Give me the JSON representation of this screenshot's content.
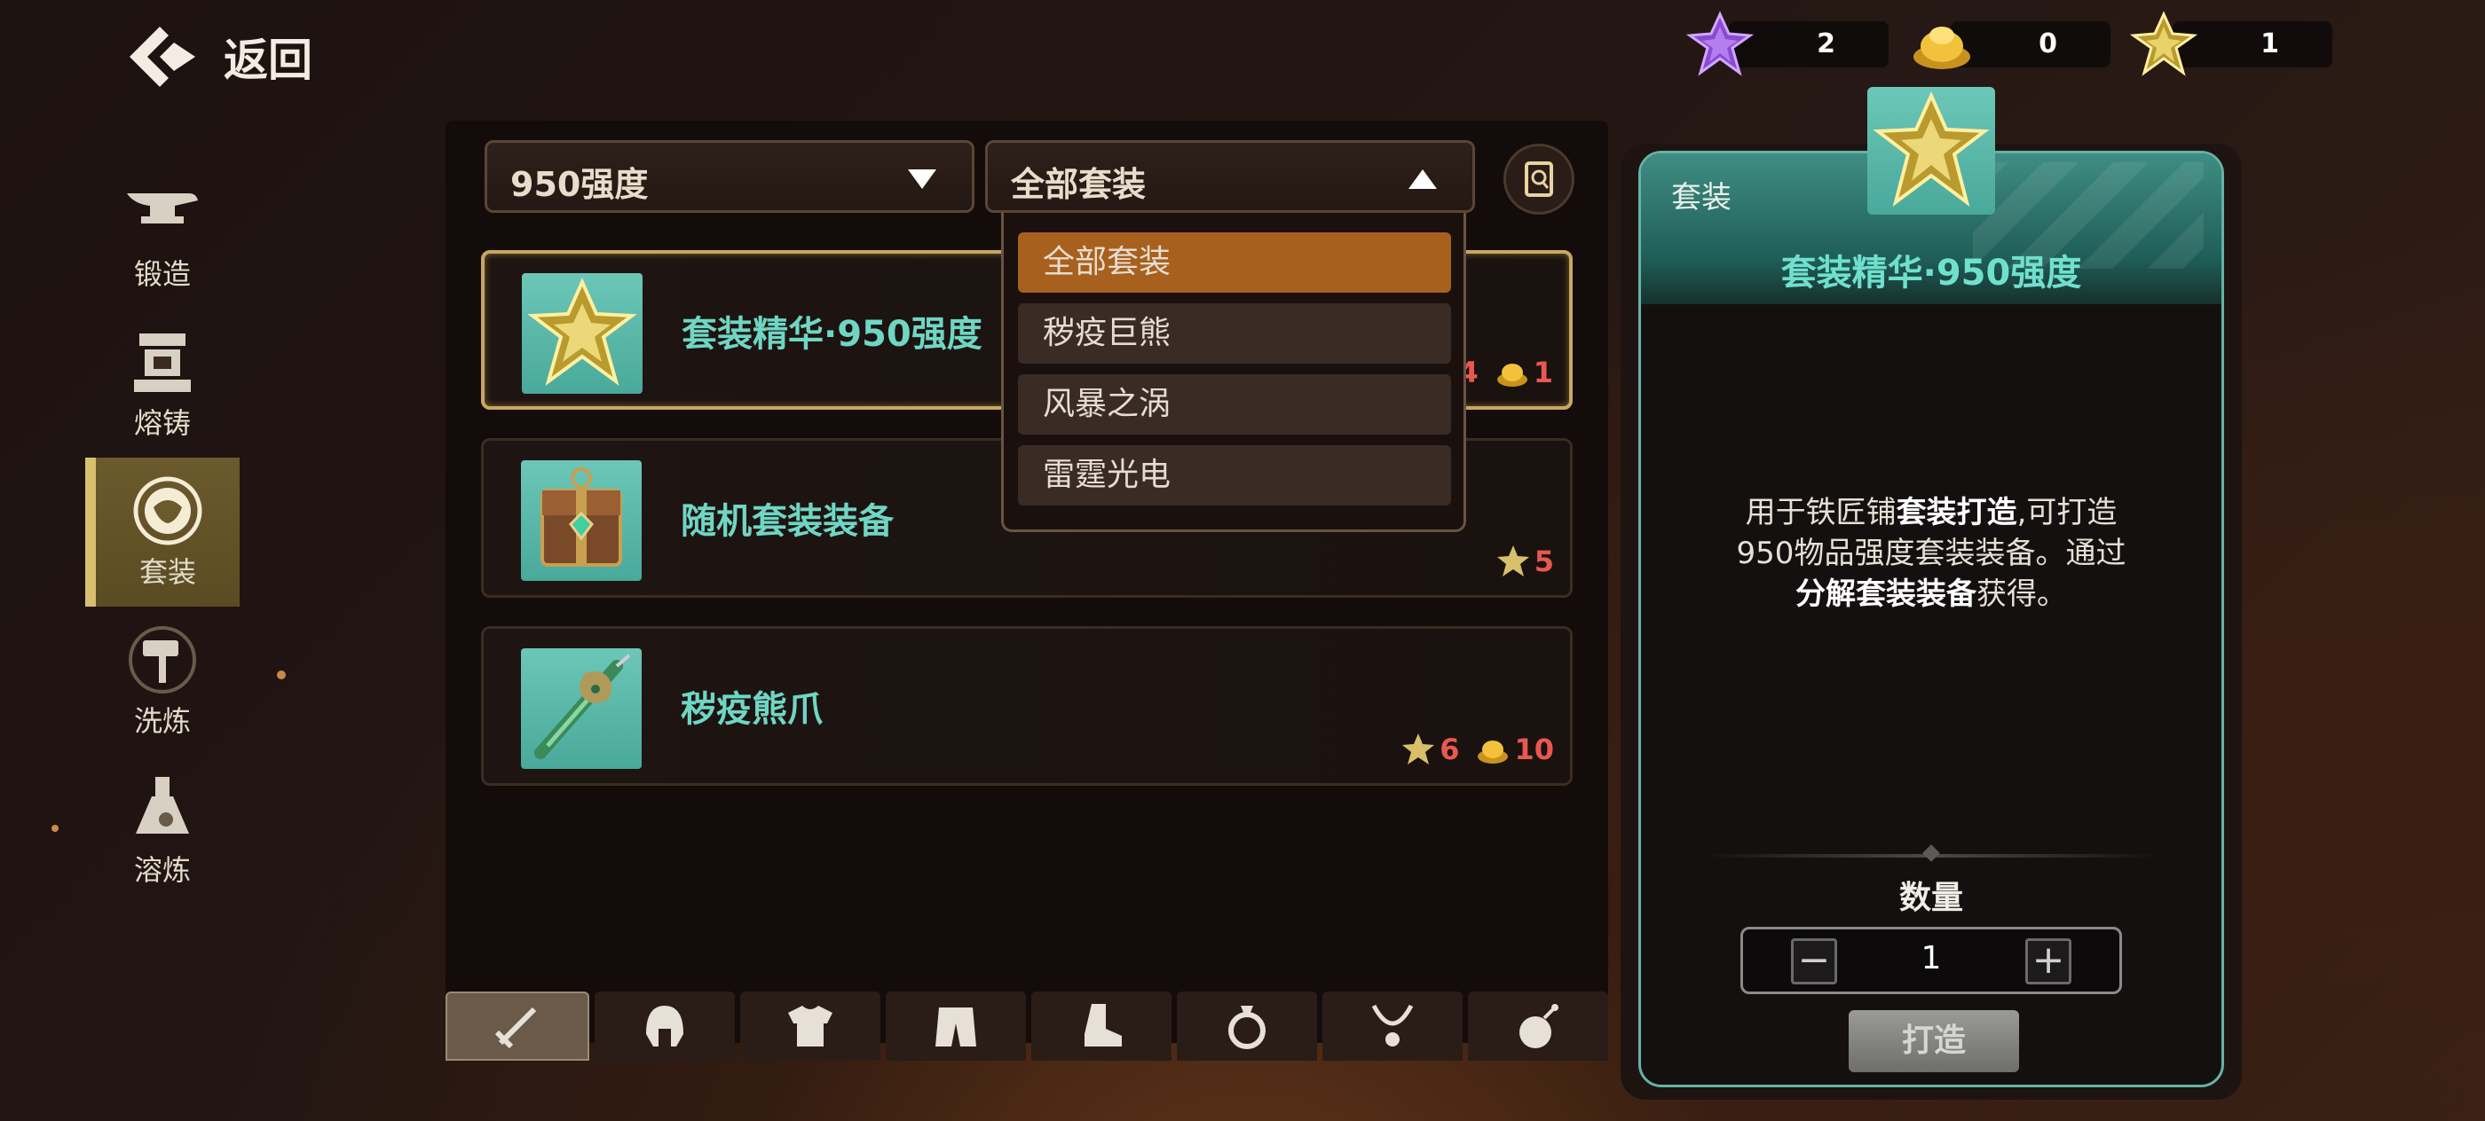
{
  "back": {
    "label": "返回"
  },
  "currencies": [
    {
      "name": "purple-crystal",
      "value": "2"
    },
    {
      "name": "gold-pile",
      "value": "0"
    },
    {
      "name": "gold-crystal",
      "value": "1"
    }
  ],
  "nav": {
    "items": [
      {
        "label": "锻造",
        "icon": "anvil-icon"
      },
      {
        "label": "熔铸",
        "icon": "furnace-icon"
      },
      {
        "label": "套装",
        "icon": "set-emblem-icon",
        "active": true
      },
      {
        "label": "洗炼",
        "icon": "hammer-icon"
      },
      {
        "label": "溶炼",
        "icon": "flask-icon"
      }
    ]
  },
  "filters": {
    "strength": "950强度",
    "set": "全部套装"
  },
  "set_menu": [
    "全部套装",
    "秽疫巨熊",
    "风暴之涡",
    "雷霆光电"
  ],
  "items": [
    {
      "name": "套装精华·950强度",
      "cost_crystal": "4",
      "cost_gold": "1",
      "selected": true
    },
    {
      "name": "随机套装装备",
      "cost_crystal": "5"
    },
    {
      "name": "秽疫熊爪",
      "cost_crystal": "6",
      "cost_gold": "10"
    }
  ],
  "tabs": [
    "sword-icon",
    "helmet-icon",
    "armor-icon",
    "pants-icon",
    "boot-icon",
    "ring-icon",
    "necklace-icon",
    "bomb-icon"
  ],
  "detail": {
    "tag": "套装",
    "name": "套装精华·950强度",
    "desc_a": "用于铁匠铺",
    "desc_b": "套装打造",
    "desc_c": ",可打造",
    "desc_d": "950物品强度套装装备。通过",
    "desc_e": "分解套装装备",
    "desc_f": "获得。",
    "qty_label": "数量",
    "qty": "1",
    "minus": "−",
    "plus": "+",
    "craft": "打造"
  },
  "colors": {
    "accent_teal": "#6fd6c4",
    "gold": "#c8a860",
    "cost_red": "#e95850",
    "menu_selected": "#a8601e"
  }
}
